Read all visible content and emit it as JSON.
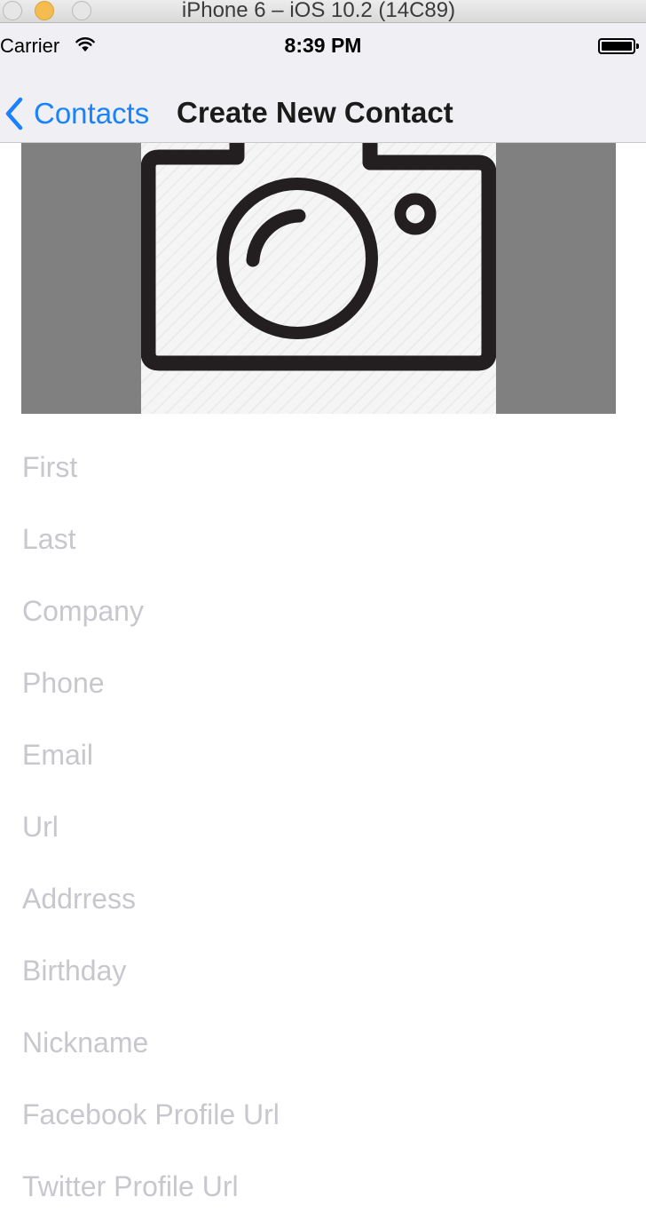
{
  "simulator": {
    "title": "iPhone 6 – iOS 10.2 (14C89)"
  },
  "status_bar": {
    "carrier": "Carrier",
    "time": "8:39 PM"
  },
  "nav": {
    "back_label": "Contacts",
    "title": "Create New Contact"
  },
  "form": {
    "fields": [
      {
        "placeholder": "First",
        "value": ""
      },
      {
        "placeholder": "Last",
        "value": ""
      },
      {
        "placeholder": "Company",
        "value": ""
      },
      {
        "placeholder": "Phone",
        "value": ""
      },
      {
        "placeholder": "Email",
        "value": ""
      },
      {
        "placeholder": "Url",
        "value": ""
      },
      {
        "placeholder": "Addrress",
        "value": ""
      },
      {
        "placeholder": "Birthday",
        "value": ""
      },
      {
        "placeholder": "Nickname",
        "value": ""
      },
      {
        "placeholder": "Facebook Profile Url",
        "value": ""
      },
      {
        "placeholder": "Twitter Profile Url",
        "value": ""
      }
    ]
  },
  "colors": {
    "tint": "#1a82fb",
    "bar_background": "#efeff4",
    "placeholder": "#c7c7cd",
    "photo_background": "#808080"
  },
  "icons": {
    "photo": "camera-icon",
    "back": "chevron-left-icon"
  }
}
